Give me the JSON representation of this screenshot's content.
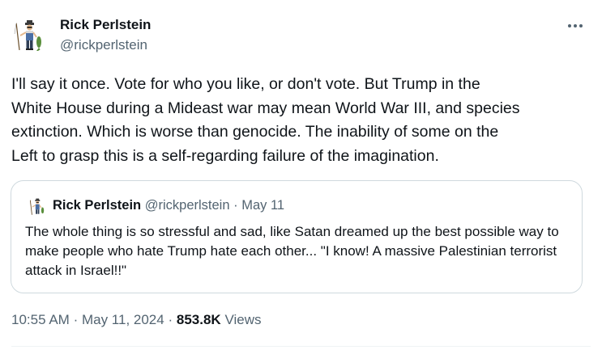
{
  "author": {
    "name": "Rick Perlstein",
    "handle": "@rickperlstein",
    "avatar_icon": "fisherman-figure-icon"
  },
  "menu": {
    "icon": "more-options-icon"
  },
  "tweet": {
    "text": "I'll say it once. Vote for who you like, or don't vote. But Trump in the\nWhite House during a Mideast war may mean World War III, and species\nextinction. Which is worse than genocide. The inability of some on the\nLeft to grasp this is a self-regarding failure of the imagination."
  },
  "quote": {
    "name": "Rick Perlstein",
    "handle": "@rickperlstein",
    "separator": "·",
    "date": "May 11",
    "text": "The whole thing is so stressful and sad, like Satan dreamed up the best possible way to make people who hate Trump hate each other... \"I know! A massive Palestinian terrorist attack in Israel!!\""
  },
  "meta": {
    "time": "10:55 AM",
    "separator": "·",
    "date": "May 11, 2024",
    "views_count": "853.8K",
    "views_label": "Views"
  },
  "colors": {
    "text_primary": "#0f1419",
    "text_secondary": "#536471",
    "border": "#cfd9de",
    "background": "#ffffff"
  }
}
